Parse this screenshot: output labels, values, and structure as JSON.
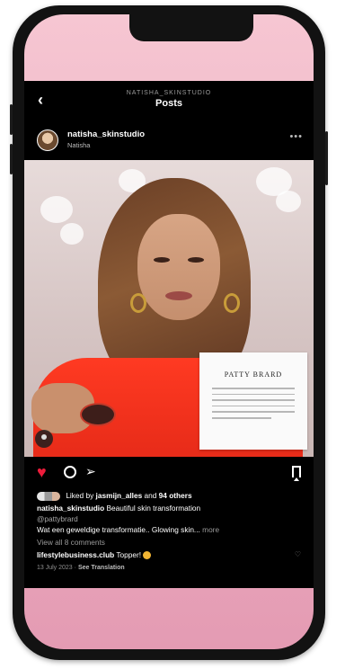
{
  "header": {
    "subtitle": "NATISHA_SKINSTUDIO",
    "title": "Posts",
    "back_icon": "chevron-left-icon"
  },
  "post": {
    "username": "natisha_skinstudio",
    "display_name": "Natisha",
    "more_icon": "more-icon",
    "image_card": {
      "brand": "PATTY BRARD"
    },
    "actions": {
      "like_icon": "heart-icon",
      "comment_icon": "comment-icon",
      "share_icon": "send-icon",
      "save_icon": "bookmark-icon"
    },
    "likes": {
      "prefix": "Liked by",
      "user": "jasmijn_alles",
      "joiner": "and",
      "others": "94 others"
    },
    "caption": {
      "user": "natisha_skinstudio",
      "text": "Beautiful skin transformation",
      "mention": "@pattybrard",
      "line2": "Wat een geweldige transformatie.. Glowing skin... ",
      "more": "more"
    },
    "view_comments": "View all 8 comments",
    "comment": {
      "user": "lifestylebusiness.club",
      "text": "Topper!"
    },
    "date": "13 July 2023",
    "see_translation": "See Translation"
  },
  "colors": {
    "like": "#ed1c3b",
    "app_bg": "#000000",
    "screen_gradient_top": "#f6c6d2",
    "screen_gradient_bottom": "#e49bb3"
  }
}
